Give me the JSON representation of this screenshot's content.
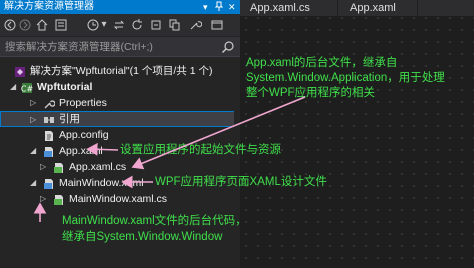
{
  "panel": {
    "title": "解决方案资源管理器",
    "title_icons": [
      "dropdown-icon",
      "pin-icon",
      "close-icon"
    ],
    "search_placeholder": "搜索解决方案资源管理器(Ctrl+;)"
  },
  "toolbar": {
    "icons": [
      "back-icon",
      "forward-icon",
      "home-icon",
      "solution-view-icon",
      "history-icon",
      "dropdown-icon",
      "sync-icon",
      "refresh-icon",
      "collapse-icon",
      "show-all-icon",
      "properties-icon",
      "preview-icon"
    ]
  },
  "tree": {
    "items": [
      {
        "label": "解决方案\"Wpftutorial\"(1 个项目/共 1 个)",
        "icon": "solution-icon",
        "expander": ""
      },
      {
        "label": "Wpftutorial",
        "icon": "csharp-project-icon",
        "expander": "◢"
      },
      {
        "label": "Properties",
        "icon": "wrench-icon",
        "expander": "▷"
      },
      {
        "label": "引用",
        "icon": "references-icon",
        "expander": "▷"
      },
      {
        "label": "App.config",
        "icon": "config-icon",
        "expander": ""
      },
      {
        "label": "App.xaml",
        "icon": "xaml-icon",
        "expander": "◢"
      },
      {
        "label": "App.xaml.cs",
        "icon": "csharp-file-icon",
        "expander": "▷"
      },
      {
        "label": "MainWindow.xaml",
        "icon": "xaml-icon",
        "expander": "◢"
      },
      {
        "label": "MainWindow.xaml.cs",
        "icon": "csharp-file-icon",
        "expander": "▷"
      }
    ]
  },
  "editor": {
    "tabs": [
      "App.xaml.cs",
      "App.xaml"
    ]
  },
  "annotations": {
    "app_xaml_cs_line1": "App.xaml的后台文件，继承自",
    "app_xaml_cs_line2": "System.Window.Application，用于处理",
    "app_xaml_cs_line3": "整个WPF应用程序的相关",
    "app_xaml": "设置应用程序的起始文件与资源",
    "mainwindow_xaml": "WPF应用程序页面XAML设计文件",
    "mainwindow_cs_line1": "MainWindow.xaml文件的后台代码，",
    "mainwindow_cs_line2": "继承自System.Window.Window"
  },
  "colors": {
    "accent": "#007acc",
    "annotation": "#3fe04a",
    "arrow": "#f0a6cf",
    "csharp": "#58b34f",
    "xaml": "#4a90d9"
  }
}
